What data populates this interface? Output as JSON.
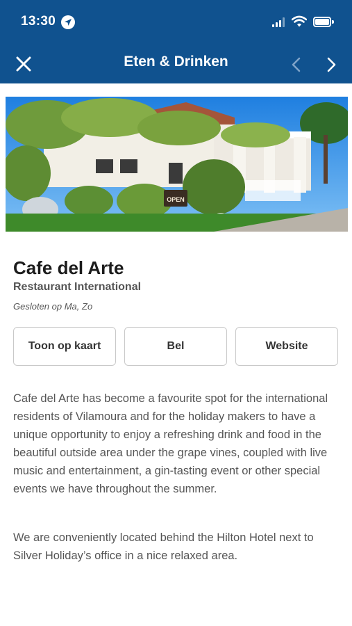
{
  "status_bar": {
    "time": "13:30",
    "icons": [
      "location-arrow-icon",
      "signal-icon",
      "wifi-icon",
      "battery-icon"
    ]
  },
  "nav": {
    "title": "Eten & Drinken",
    "close_icon": "close-icon",
    "prev_icon": "chevron-left-icon",
    "next_icon": "chevron-right-icon"
  },
  "colors": {
    "header_bg": "#10528f",
    "header_text": "#ffffff",
    "prev_disabled": "#7fa3c8"
  },
  "hero": {
    "sign_text": "OPEN"
  },
  "venue": {
    "name": "Cafe del Arte",
    "category": "Restaurant International",
    "closed_on": "Gesloten op Ma, Zo"
  },
  "actions": {
    "map_label": "Toon op kaart",
    "call_label": "Bel",
    "website_label": "Website"
  },
  "description": {
    "paragraph1": "Cafe del Arte has become a favourite spot for the international residents of Vilamoura and for the holiday makers to have a unique opportunity to enjoy a refreshing drink and food in the beautiful outside area under the grape vines, coupled with live music and entertainment, a gin-tasting event or other special events we have throughout the summer.",
    "paragraph2": "We are conveniently located behind the Hilton Hotel next to Silver Holiday’s office in a nice relaxed area."
  }
}
